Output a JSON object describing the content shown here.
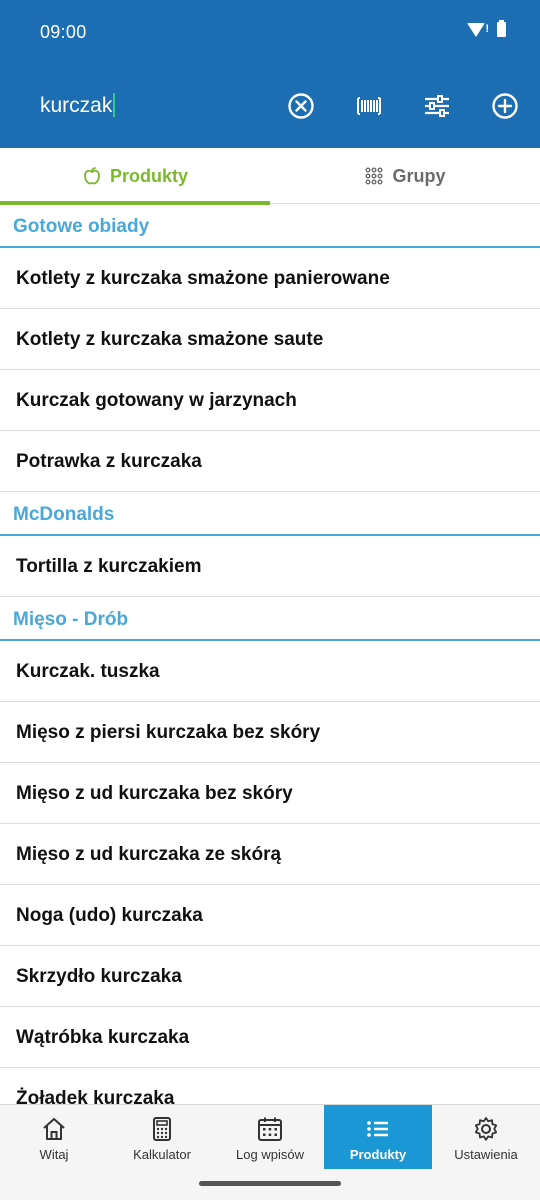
{
  "status_bar": {
    "time": "09:00"
  },
  "search": {
    "query": "kurczak"
  },
  "tabs": [
    {
      "label": "Produkty",
      "active": true,
      "icon": "apple-icon"
    },
    {
      "label": "Grupy",
      "active": false,
      "icon": "grid-dots-icon"
    }
  ],
  "groups": [
    {
      "name": "Gotowe obiady",
      "items": [
        "Kotlety z kurczaka smażone panierowane",
        "Kotlety z kurczaka smażone saute",
        "Kurczak gotowany w jarzynach",
        "Potrawka z kurczaka"
      ]
    },
    {
      "name": "McDonalds",
      "items": [
        "Tortilla z kurczakiem"
      ]
    },
    {
      "name": "Mięso - Drób",
      "items": [
        "Kurczak. tuszka",
        "Mięso z piersi kurczaka bez skóry",
        "Mięso z ud kurczaka bez skóry",
        "Mięso z ud kurczaka ze skórą",
        "Noga (udo) kurczaka",
        "Skrzydło kurczaka",
        "Wątróbka  kurczaka",
        "Żołądek kurczaka"
      ]
    }
  ],
  "bottom_nav": [
    {
      "label": "Witaj",
      "icon": "home-icon",
      "active": false
    },
    {
      "label": "Kalkulator",
      "icon": "calculator-icon",
      "active": false
    },
    {
      "label": "Log wpisów",
      "icon": "calendar-icon",
      "active": false
    },
    {
      "label": "Produkty",
      "icon": "list-icon",
      "active": true
    },
    {
      "label": "Ustawienia",
      "icon": "gear-icon",
      "active": false
    }
  ],
  "colors": {
    "header": "#1d6db3",
    "accent_green": "#7cb82f",
    "group_blue": "#4aa8d8",
    "nav_active": "#1a98d5"
  }
}
